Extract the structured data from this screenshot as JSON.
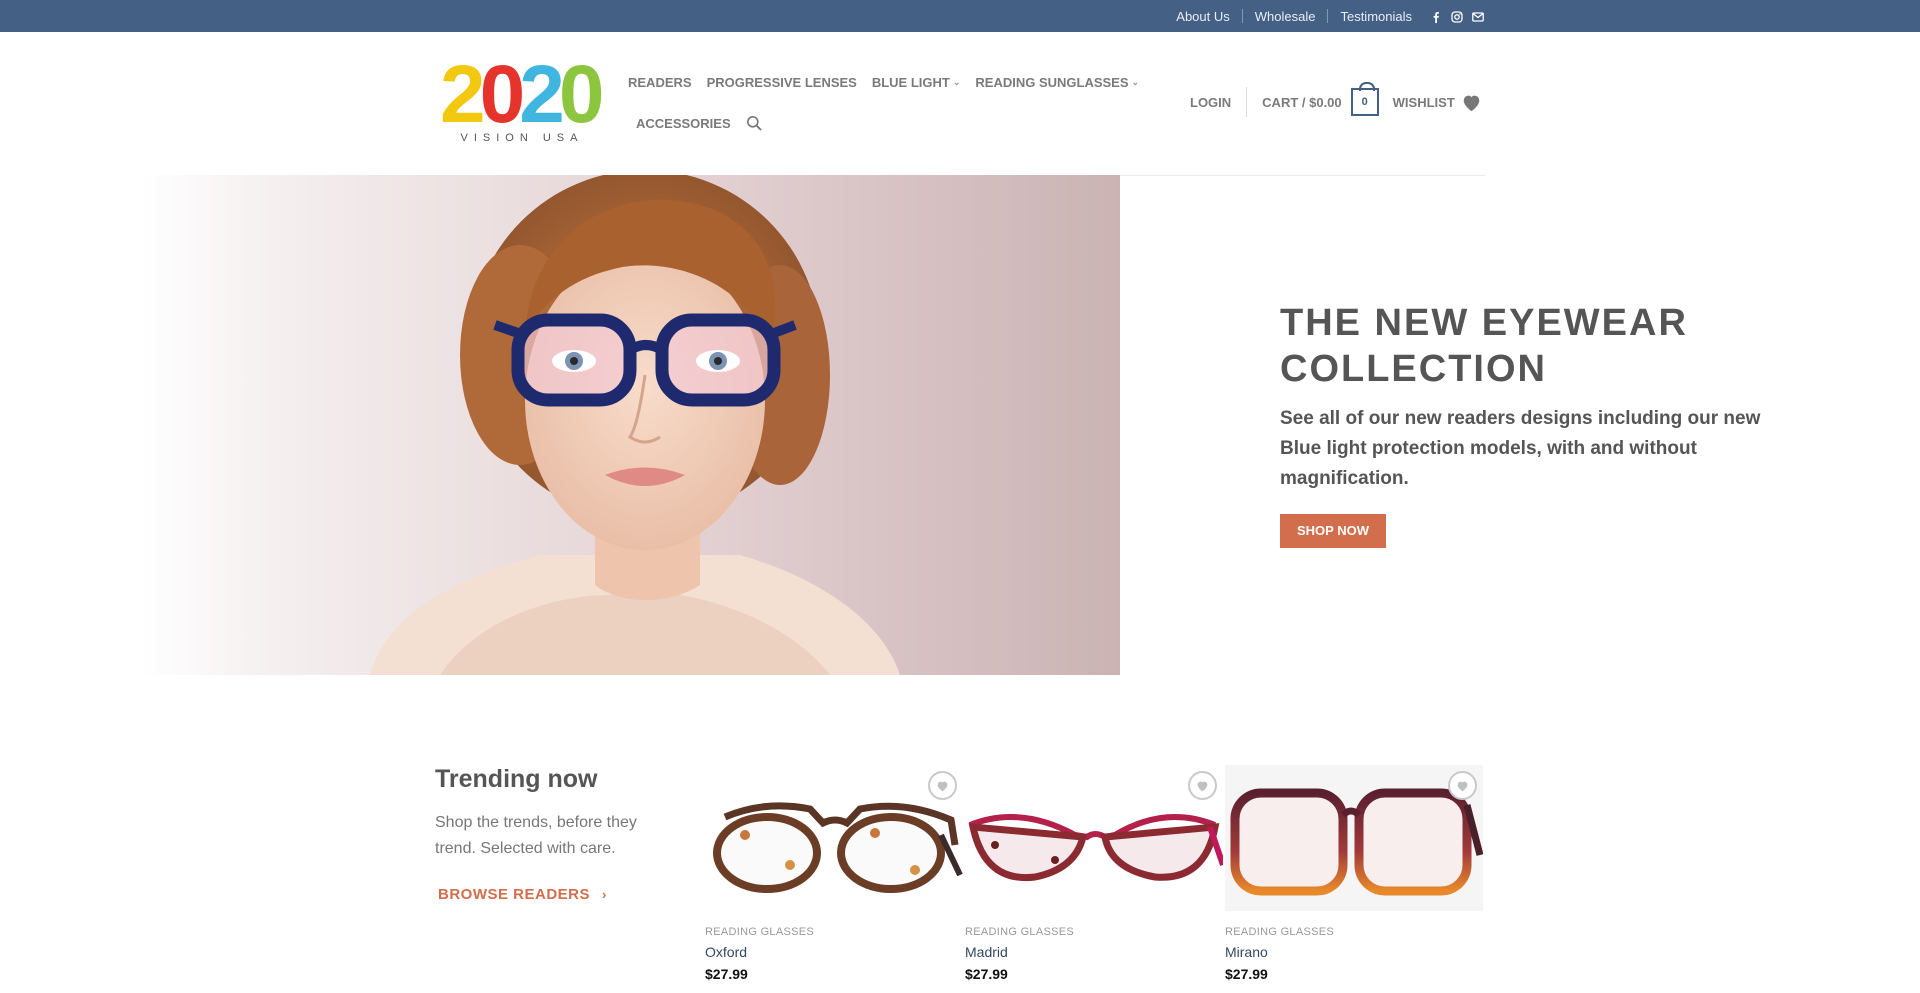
{
  "topbar": {
    "links": [
      "About Us",
      "Wholesale",
      "Testimonials"
    ],
    "icons": [
      "facebook-icon",
      "instagram-icon",
      "mail-icon"
    ],
    "background": "#446084"
  },
  "logo": {
    "digits": [
      "2",
      "0",
      "2",
      "0"
    ],
    "digit_colors": [
      "#f2c811",
      "#e5342c",
      "#3fb5e0",
      "#8cc63f"
    ],
    "subtitle": "VISION USA"
  },
  "nav": {
    "row1": [
      {
        "label": "READERS"
      },
      {
        "label": "PROGRESSIVE LENSES"
      },
      {
        "label": "BLUE LIGHT"
      },
      {
        "label": "READING SUNGLASSES"
      }
    ],
    "row2": [
      {
        "label": "ACCESSORIES"
      }
    ]
  },
  "account": {
    "login": "LOGIN",
    "cart": "CART / $0.00",
    "cart_count": "0",
    "wishlist": "WISHLIST"
  },
  "hero": {
    "title": "THE NEW EYEWEAR COLLECTION",
    "subtitle": "See all of our new readers designs including our new Blue light protection models, with and without magnification.",
    "button": "SHOP NOW",
    "accent": "#d26e4b"
  },
  "trending": {
    "title": "Trending now",
    "text": "Shop the trends, before they trend. Selected with care.",
    "link": "BROWSE READERS"
  },
  "products": [
    {
      "category": "READING GLASSES",
      "name": "Oxford",
      "price": "$27.99"
    },
    {
      "category": "READING GLASSES",
      "name": "Madrid",
      "price": "$27.99"
    },
    {
      "category": "READING GLASSES",
      "name": "Mirano",
      "price": "$27.99"
    }
  ]
}
